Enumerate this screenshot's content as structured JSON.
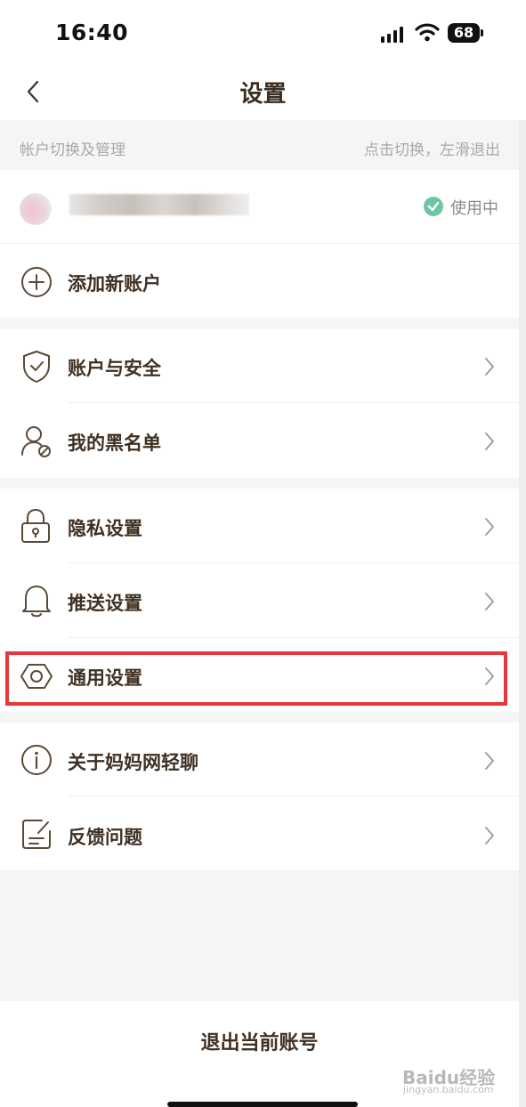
{
  "status_bar": {
    "time": "16:40",
    "battery": "68",
    "signal_icon": "signal-bars-icon",
    "wifi_icon": "wifi-icon"
  },
  "nav": {
    "title": "设置",
    "back_icon": "chevron-left-icon"
  },
  "account_section": {
    "header_left": "帐户切换及管理",
    "header_right": "点击切换，左滑退出",
    "current_status": "使用中",
    "add_account": "添加新账户"
  },
  "groups": [
    {
      "items": [
        {
          "label": "账户与安全",
          "icon": "shield-check-icon"
        },
        {
          "label": "我的黑名单",
          "icon": "user-blocked-icon"
        }
      ]
    },
    {
      "items": [
        {
          "label": "隐私设置",
          "icon": "lock-icon"
        },
        {
          "label": "推送设置",
          "icon": "bell-icon"
        },
        {
          "label": "通用设置",
          "icon": "hexagon-settings-icon"
        }
      ]
    },
    {
      "items": [
        {
          "label": "关于妈妈网轻聊",
          "icon": "info-icon"
        },
        {
          "label": "反馈问题",
          "icon": "feedback-edit-icon"
        }
      ]
    }
  ],
  "logout": "退出当前账号",
  "watermark": {
    "logo": "Baidu经验",
    "url": "jingyan.baidu.com"
  },
  "colors": {
    "highlight": "#e8373b",
    "in_use": "#6cc7a0",
    "text": "#3f3022"
  }
}
